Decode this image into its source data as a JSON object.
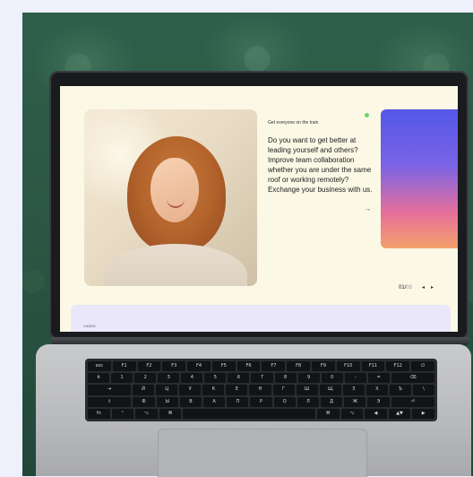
{
  "screen": {
    "eyebrow": "Get everyone on the train",
    "body": "Do you want to get better at leading yourself and others? Improve team collaboration whether you are under the same roof or working remotely? Exchange your business with us.",
    "arrow_icon": "arrow-right-icon",
    "pager": {
      "current": "01",
      "separator": "/",
      "total": "05"
    },
    "prev_icon": "chevron-left-icon",
    "next_icon": "chevron-right-icon",
    "bottom_label": "CASES"
  },
  "colors": {
    "screen_bg": "#fbf8e6",
    "status_dot": "#6fd16a",
    "gradient": [
      "#5457e8",
      "#e7709a",
      "#f3a06a"
    ],
    "sofa": "#2f5f4a"
  },
  "keyboard": {
    "rows": [
      [
        "esc",
        "F1",
        "F2",
        "F3",
        "F4",
        "F5",
        "F6",
        "F7",
        "F8",
        "F9",
        "F10",
        "F11",
        "F12",
        "⏻"
      ],
      [
        "ё",
        "1",
        "2",
        "3",
        "4",
        "5",
        "6",
        "7",
        "8",
        "9",
        "0",
        "-",
        "=",
        "⌫"
      ],
      [
        "⇥",
        "Й",
        "Ц",
        "У",
        "К",
        "Е",
        "Н",
        "Г",
        "Ш",
        "Щ",
        "З",
        "Х",
        "Ъ",
        "\\"
      ],
      [
        "⇪",
        "Ф",
        "Ы",
        "В",
        "А",
        "П",
        "Р",
        "О",
        "Л",
        "Д",
        "Ж",
        "Э",
        "⏎"
      ],
      [
        "fn",
        "⌃",
        "⌥",
        "⌘",
        "",
        "⌘",
        "⌥",
        "◀",
        "▲▼",
        "▶"
      ]
    ]
  }
}
